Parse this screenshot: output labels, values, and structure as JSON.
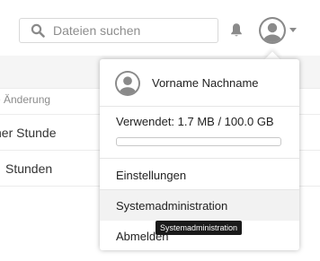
{
  "search": {
    "placeholder": "Dateien suchen",
    "value": ""
  },
  "header": {
    "icons": {
      "search": "search-icon",
      "notifications": "bell-icon",
      "avatar": "user-avatar-icon",
      "menu_toggle": "caret-down-icon"
    }
  },
  "file_list": {
    "column_header": "e Änderung",
    "rows": [
      {
        "modified": "ner Stunde"
      },
      {
        "modified": "Stunden"
      }
    ]
  },
  "user_menu": {
    "name": "Vorname Nachname",
    "usage_text": "Verwendet: 1.7 MB / 100.0 GB",
    "usage_fraction": 1.7e-05,
    "items": [
      {
        "label": "Einstellungen"
      },
      {
        "label": "Systemadministration"
      },
      {
        "label": "Abmelden"
      }
    ],
    "tooltip": "Systemadministration"
  },
  "colors": {
    "accent": "#0082c9",
    "icon_gray": "#8a8a8a",
    "tooltip_bg": "#1a1a1a"
  }
}
